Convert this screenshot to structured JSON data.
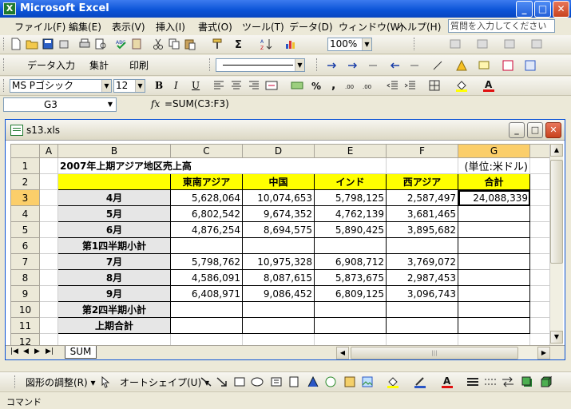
{
  "app": {
    "title": "Microsoft Excel",
    "icon_letter": "X",
    "minimize": "_",
    "maximize": "□",
    "close": "✕"
  },
  "menu": {
    "items": [
      "ファイル(F)",
      "編集(E)",
      "表示(V)",
      "挿入(I)",
      "書式(O)",
      "ツール(T)",
      "データ(D)",
      "ウィンドウ(W)",
      "ヘルプ(H)"
    ],
    "help_placeholder": "質問を入力してください"
  },
  "toolbar_standard": {
    "zoom": "100%"
  },
  "toolbar_custom": {
    "items": [
      "データ入力",
      "集計",
      "印刷"
    ]
  },
  "toolbar_format": {
    "font": "MS Pゴシック",
    "size": "12",
    "bold": "B",
    "italic": "I",
    "underline": "U"
  },
  "formula_bar": {
    "name_box": "G3",
    "fx": "fx",
    "formula": "=SUM(C3:F3)"
  },
  "workbook": {
    "filename": "s13.xls",
    "minimize": "_",
    "maximize": "□",
    "close": "✕"
  },
  "grid": {
    "columns": [
      "A",
      "B",
      "C",
      "D",
      "E",
      "F",
      "G"
    ],
    "selected_column": "G",
    "selected_row": "3",
    "rows": [
      {
        "n": "1",
        "title": "2007年上期アジア地区売上高",
        "unit": "(単位:米ドル)"
      },
      {
        "n": "2",
        "headers": [
          "東南アジア",
          "中国",
          "インド",
          "西アジア",
          "合計"
        ]
      },
      {
        "n": "3",
        "label": "4月",
        "vals": [
          "5,628,064",
          "10,074,653",
          "5,798,125",
          "2,587,497",
          "24,088,339"
        ]
      },
      {
        "n": "4",
        "label": "5月",
        "vals": [
          "6,802,542",
          "9,674,352",
          "4,762,139",
          "3,681,465",
          ""
        ]
      },
      {
        "n": "5",
        "label": "6月",
        "vals": [
          "4,876,254",
          "8,694,575",
          "5,890,425",
          "3,895,682",
          ""
        ]
      },
      {
        "n": "6",
        "label": "第1四半期小計",
        "vals": [
          "",
          "",
          "",
          "",
          ""
        ]
      },
      {
        "n": "7",
        "label": "7月",
        "vals": [
          "5,798,762",
          "10,975,328",
          "6,908,712",
          "3,769,072",
          ""
        ]
      },
      {
        "n": "8",
        "label": "8月",
        "vals": [
          "4,586,091",
          "8,087,615",
          "5,873,675",
          "2,987,453",
          ""
        ]
      },
      {
        "n": "9",
        "label": "9月",
        "vals": [
          "6,408,971",
          "9,086,452",
          "6,809,125",
          "3,096,743",
          ""
        ]
      },
      {
        "n": "10",
        "label": "第2四半期小計",
        "vals": [
          "",
          "",
          "",
          "",
          ""
        ]
      },
      {
        "n": "11",
        "label": "上期合計",
        "vals": [
          "",
          "",
          "",
          "",
          ""
        ]
      },
      {
        "n": "12"
      }
    ]
  },
  "sheet_tabs": {
    "active": "SUM"
  },
  "drawing_toolbar": {
    "adjust": "図形の調整(R) ▾",
    "autoshape": "オートシェイプ(U) ▾"
  },
  "status": {
    "text": "コマンド"
  },
  "colors": {
    "header_yellow": "#ffff00",
    "label_gray": "#e6e6e6",
    "selected_header": "#fbce6a",
    "title_blue": "#0a52d6"
  }
}
